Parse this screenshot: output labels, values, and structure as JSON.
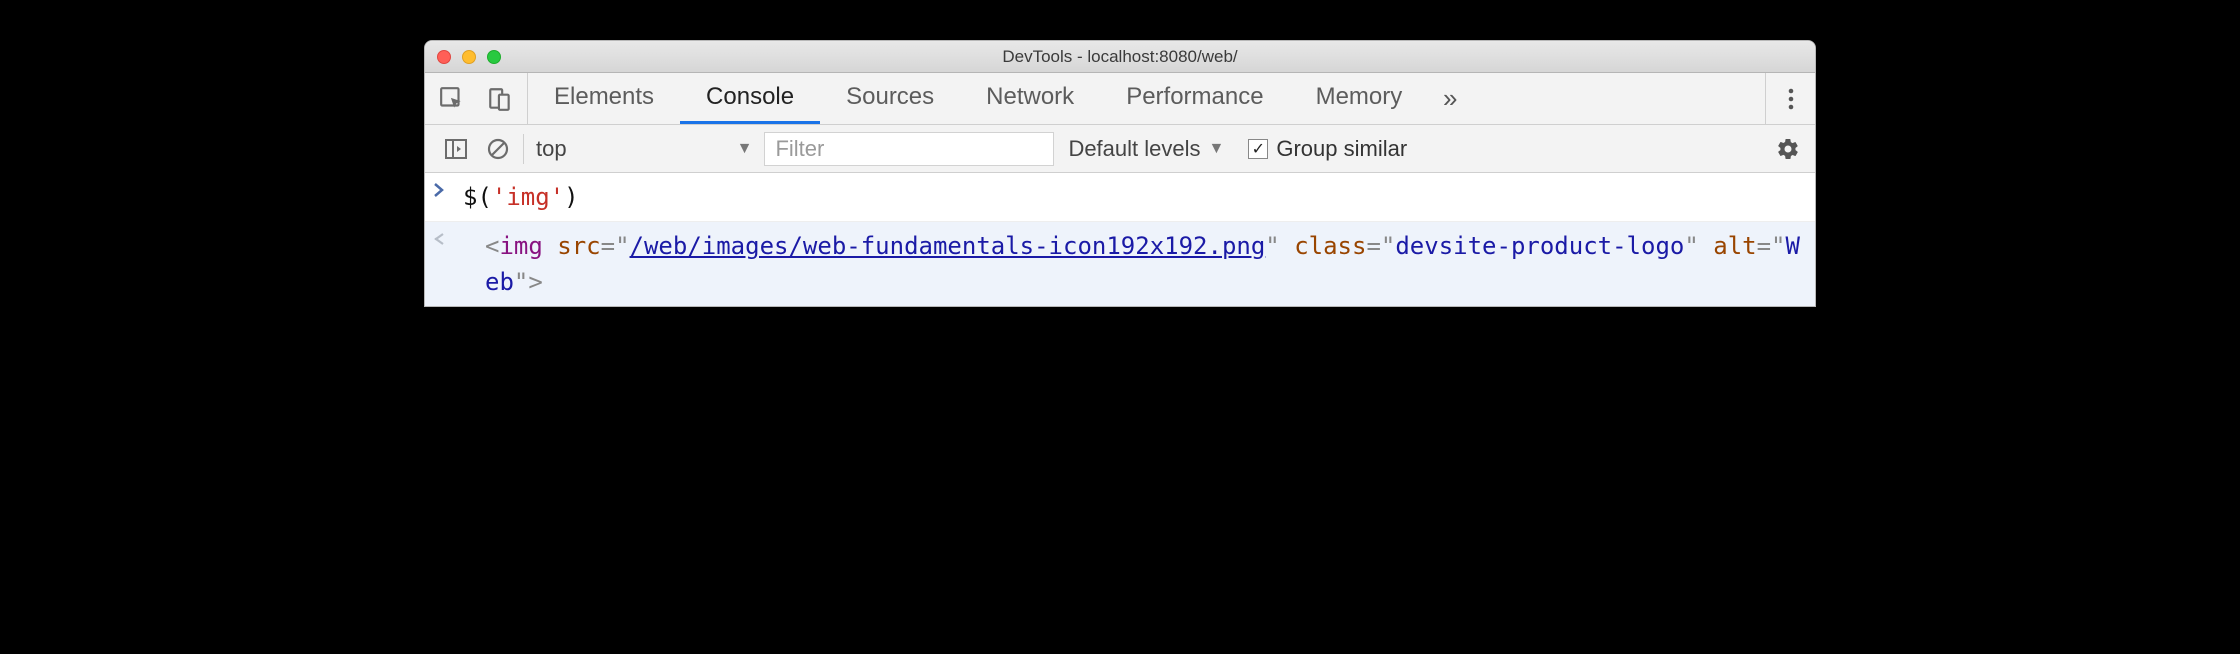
{
  "window": {
    "title": "DevTools - localhost:8080/web/"
  },
  "tabs": {
    "items": [
      "Elements",
      "Console",
      "Sources",
      "Network",
      "Performance",
      "Memory"
    ],
    "active_index": 1,
    "overflow_glyph": "»"
  },
  "toolbar": {
    "context_label": "top",
    "filter_placeholder": "Filter",
    "levels_label": "Default levels",
    "group_similar_label": "Group similar",
    "group_similar_checked": true
  },
  "console": {
    "input": {
      "fn": "$",
      "arg": "'img'"
    },
    "output": {
      "tag": "img",
      "attrs": [
        {
          "name": "src",
          "value": "/web/images/web-fundamentals-icon192x192.png",
          "link": true
        },
        {
          "name": "class",
          "value": "devsite-product-logo",
          "link": false
        },
        {
          "name": "alt",
          "value": "Web",
          "link": false
        }
      ]
    }
  }
}
